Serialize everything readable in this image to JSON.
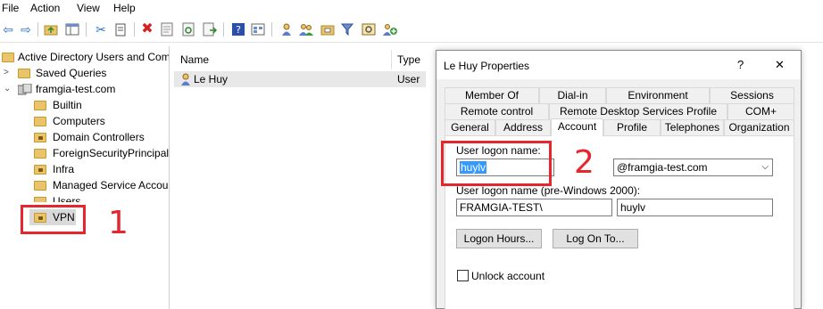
{
  "menu": [
    "File",
    "Action",
    "View",
    "Help"
  ],
  "toolbar": {
    "icons": [
      "back-arrow-icon",
      "forward-arrow-icon",
      "up-folder-icon",
      "show-hide-tree-icon",
      "cut-icon",
      "copy-icon",
      "delete-icon",
      "properties-icon",
      "refresh-icon",
      "export-list-icon",
      "help-icon",
      "view-icon",
      "new-user-icon",
      "new-group-icon",
      "new-ou-icon",
      "filter-icon",
      "find-icon",
      "add-to-group-icon"
    ]
  },
  "tree": {
    "root": "Active Directory Users and Com",
    "saved_queries": "Saved Queries",
    "domain": "framgia-test.com",
    "children": [
      "Builtin",
      "Computers",
      "Domain Controllers",
      "ForeignSecurityPrincipals",
      "Infra",
      "Managed Service Accour",
      "Users",
      "VPN"
    ]
  },
  "list": {
    "col_name": "Name",
    "col_type": "Type",
    "rows": [
      {
        "name": "Le Huy",
        "type": "User"
      }
    ]
  },
  "dialog": {
    "title": "Le Huy Properties",
    "help": "?",
    "close": "✕",
    "tabs_row1": [
      "Member Of",
      "Dial-in",
      "Environment",
      "Sessions"
    ],
    "tabs_row2": [
      "Remote control",
      "Remote Desktop Services Profile",
      "COM+"
    ],
    "tabs_row3": [
      "General",
      "Address",
      "Account",
      "Profile",
      "Telephones",
      "Organization"
    ],
    "selected_tab": "Account",
    "logon_label": "User logon name:",
    "logon_value": "huylv",
    "domain_value": "@framgia-test.com",
    "pre2000_label": "User logon name (pre-Windows 2000):",
    "pre2000_domain": "FRAMGIA-TEST\\",
    "pre2000_user": "huylv",
    "logon_hours": "Logon Hours...",
    "log_on_to": "Log On To...",
    "unlock": "Unlock account"
  },
  "annotations": {
    "one": "1",
    "two": "2"
  },
  "colors": {
    "annotation": "#e5262e",
    "selection": "#3399ff",
    "folder": "#e9c46a"
  }
}
